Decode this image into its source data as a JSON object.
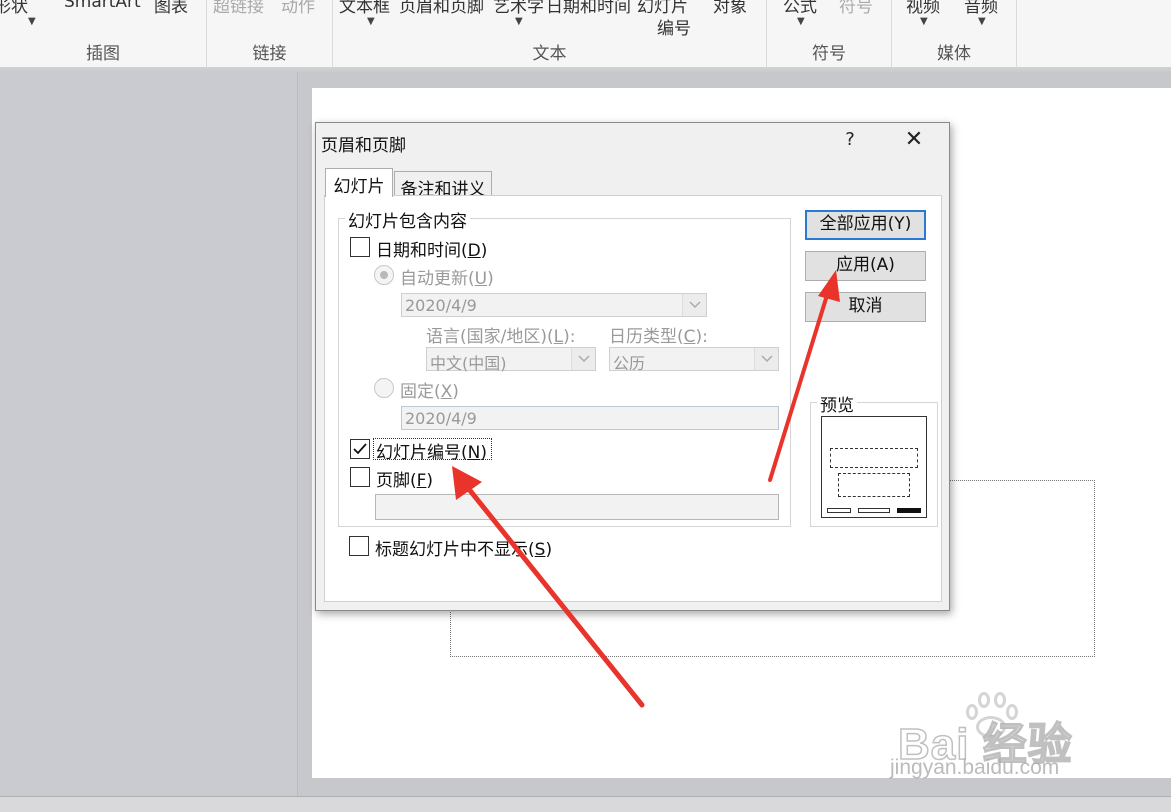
{
  "ribbon": {
    "groups": [
      {
        "label": "插图",
        "items": [
          "形状",
          "SmartArt",
          "图表"
        ]
      },
      {
        "label": "链接",
        "items": [
          "超链接",
          "动作"
        ]
      },
      {
        "label": "文本",
        "items": [
          "文本框",
          "页眉和页脚",
          "艺术字",
          "日期和时间",
          "幻灯片",
          "编号",
          "对象"
        ]
      },
      {
        "label": "符号",
        "items": [
          "公式",
          "符号"
        ]
      },
      {
        "label": "媒体",
        "items": [
          "视频",
          "音频"
        ]
      }
    ]
  },
  "dialog": {
    "title": "页眉和页脚",
    "help": "?",
    "close": "✕",
    "tabs": [
      {
        "label": "幻灯片",
        "active": true
      },
      {
        "label": "备注和讲义",
        "active": false
      }
    ],
    "content_group": "幻灯片包含内容",
    "date_time": {
      "label": "日期和时间",
      "hotkey": "D",
      "checked": false
    },
    "auto_update": {
      "label": "自动更新",
      "hotkey": "U",
      "selected": true,
      "disabled": true
    },
    "date_value": "2020/4/9",
    "language": {
      "label": "语言(国家/地区)",
      "hotkey": "L",
      "value": "中文(中国)"
    },
    "calendar": {
      "label": "日历类型",
      "hotkey": "C",
      "value": "公历"
    },
    "fixed": {
      "label": "固定",
      "hotkey": "X",
      "selected": false,
      "value": "2020/4/9"
    },
    "slide_number": {
      "label": "幻灯片编号",
      "hotkey": "N",
      "checked": true
    },
    "footer": {
      "label": "页脚",
      "hotkey": "F",
      "checked": false,
      "value": ""
    },
    "hide_on_title": {
      "label": "标题幻灯片中不显示",
      "hotkey": "S",
      "checked": false
    },
    "buttons": {
      "apply_all": "全部应用(Y)",
      "apply": "应用(A)",
      "cancel": "取消"
    },
    "preview_label": "预览"
  },
  "watermark": {
    "brand": "Bai 经验",
    "site": "jingyan.baidu.com"
  },
  "colors": {
    "accent": "#2a7ad4",
    "arrow": "#e8342a"
  }
}
